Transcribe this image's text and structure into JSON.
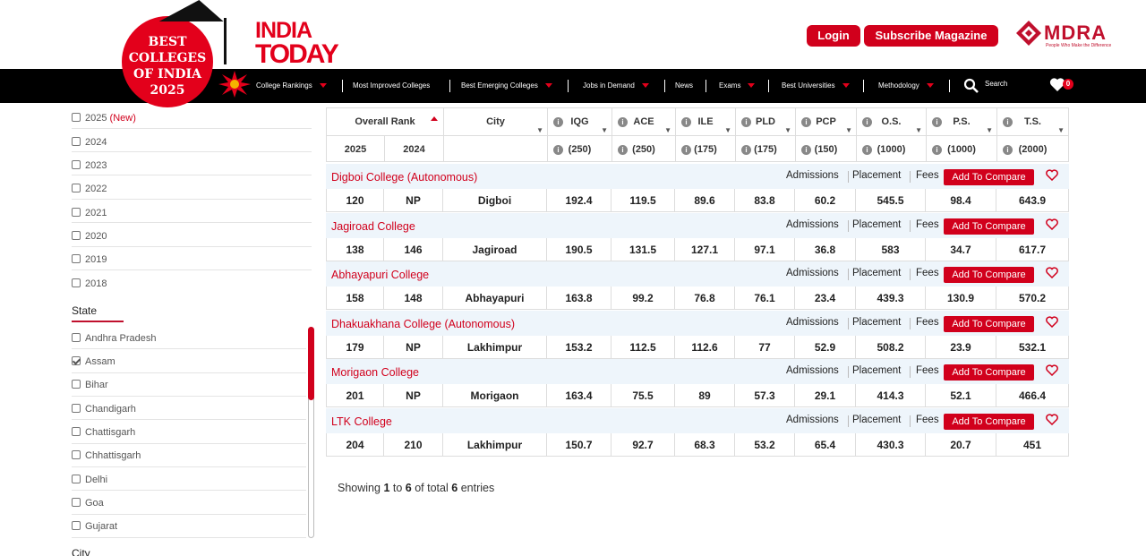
{
  "header": {
    "badge_lines": [
      "BEST",
      "COLLEGES",
      "OF INDIA",
      "2025"
    ],
    "brand_line1": "INDIA",
    "brand_line2": "TODAY",
    "login_label": "Login",
    "subscribe_label": "Subscribe Magazine",
    "partner_name": "MDRA",
    "partner_tagline": "People Who Make the Difference"
  },
  "nav": {
    "items": [
      "College Rankings",
      "Most Improved Colleges",
      "Best Emerging Colleges",
      "Jobs in Demand",
      "News",
      "Exams",
      "Best Universities",
      "Methodology"
    ],
    "search_label": "Search",
    "cart_count": "0"
  },
  "sidebar": {
    "years": [
      "2025",
      "2024",
      "2023",
      "2022",
      "2021",
      "2020",
      "2019",
      "2018"
    ],
    "new_tag": "(New)",
    "state_title": "State",
    "states": [
      "Andhra Pradesh",
      "Assam",
      "Bihar",
      "Chandigarh",
      "Chattisgarh",
      "Chhattisgarh",
      "Delhi",
      "Goa",
      "Gujarat"
    ],
    "checked_state": "Assam",
    "city_title": "City"
  },
  "table": {
    "headers": {
      "overall_rank": "Overall Rank",
      "city": "City",
      "metrics": [
        "IQG",
        "ACE",
        "ILE",
        "PLD",
        "PCP",
        "O.S.",
        "P.S.",
        "T.S."
      ]
    },
    "subheaders": {
      "rank_years": [
        "2025",
        "2024"
      ],
      "maxima": [
        "(250)",
        "(250)",
        "(175)",
        "(175)",
        "(150)",
        "(1000)",
        "(1000)",
        "(2000)"
      ]
    },
    "row_links": [
      "Admissions",
      "Placement",
      "Fees"
    ],
    "compare_label": "Add To Compare",
    "rows": [
      {
        "name": "Digboi College (Autonomous)",
        "r2025": "120",
        "r2024": "NP",
        "city": "Digboi",
        "m": [
          "192.4",
          "119.5",
          "89.6",
          "83.8",
          "60.2",
          "545.5",
          "98.4",
          "643.9"
        ]
      },
      {
        "name": "Jagiroad College",
        "r2025": "138",
        "r2024": "146",
        "city": "Jagiroad",
        "m": [
          "190.5",
          "131.5",
          "127.1",
          "97.1",
          "36.8",
          "583",
          "34.7",
          "617.7"
        ]
      },
      {
        "name": "Abhayapuri College",
        "r2025": "158",
        "r2024": "148",
        "city": "Abhayapuri",
        "m": [
          "163.8",
          "99.2",
          "76.8",
          "76.1",
          "23.4",
          "439.3",
          "130.9",
          "570.2"
        ]
      },
      {
        "name": "Dhakuakhana College (Autonomous)",
        "r2025": "179",
        "r2024": "NP",
        "city": "Lakhimpur",
        "m": [
          "153.2",
          "112.5",
          "112.6",
          "77",
          "52.9",
          "508.2",
          "23.9",
          "532.1"
        ]
      },
      {
        "name": "Morigaon College",
        "r2025": "201",
        "r2024": "NP",
        "city": "Morigaon",
        "m": [
          "163.4",
          "75.5",
          "89",
          "57.3",
          "29.1",
          "414.3",
          "52.1",
          "466.4"
        ]
      },
      {
        "name": "LTK College",
        "r2025": "204",
        "r2024": "210",
        "city": "Lakhimpur",
        "m": [
          "150.7",
          "92.7",
          "68.3",
          "53.2",
          "65.4",
          "430.3",
          "20.7",
          "451"
        ]
      }
    ]
  },
  "footer_info": {
    "prefix": "Showing",
    "from": "1",
    "to_word": "to",
    "to": "6",
    "mid": "of total",
    "total": "6",
    "suffix": "entries"
  }
}
